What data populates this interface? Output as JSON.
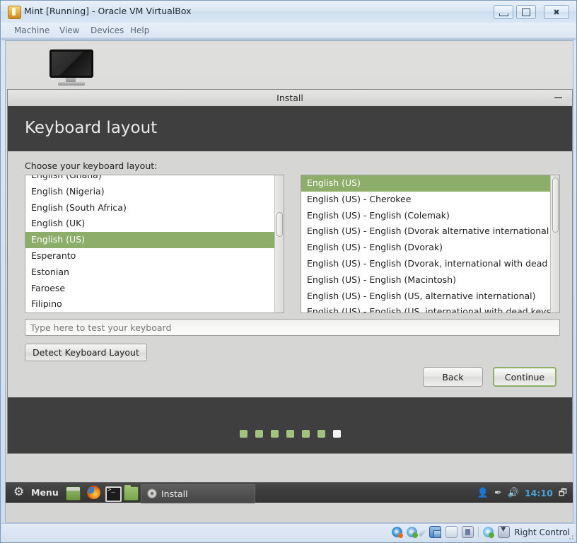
{
  "vbox": {
    "title": "Mint [Running] - Oracle VM VirtualBox",
    "icon": "virtualbox-icon",
    "window_buttons": {
      "minimize": "minimize-button",
      "maximize": "restore-button",
      "close": "close-button"
    },
    "menu": [
      "Machine",
      "View",
      "Devices",
      "Help"
    ],
    "status_bar": {
      "icons": [
        "optical-drive-icon",
        "network-icon",
        "pen-icon",
        "shared-clipboard-icon",
        "shared-folder-icon",
        "usb-icon",
        "host-network-icon",
        "host-key-icon"
      ],
      "host_key_label": "Right Control"
    }
  },
  "installer": {
    "window_title": "Install",
    "minimize": "minimize-button",
    "header_title": "Keyboard layout",
    "choose_label": "Choose your keyboard layout:",
    "left_list": {
      "name": "keyboard-language-list",
      "items": [
        {
          "label": "English (Ghana)",
          "selected": false
        },
        {
          "label": "English (Nigeria)",
          "selected": false
        },
        {
          "label": "English (South Africa)",
          "selected": false
        },
        {
          "label": "English (UK)",
          "selected": false
        },
        {
          "label": "English (US)",
          "selected": true
        },
        {
          "label": "Esperanto",
          "selected": false
        },
        {
          "label": "Estonian",
          "selected": false
        },
        {
          "label": "Faroese",
          "selected": false
        },
        {
          "label": "Filipino",
          "selected": false
        }
      ]
    },
    "right_list": {
      "name": "keyboard-variant-list",
      "items": [
        {
          "label": "English (US)",
          "selected": true
        },
        {
          "label": "English (US) - Cherokee",
          "selected": false
        },
        {
          "label": "English (US) - English (Colemak)",
          "selected": false
        },
        {
          "label": "English (US) - English (Dvorak alternative international no dead keys)",
          "selected": false
        },
        {
          "label": "English (US) - English (Dvorak)",
          "selected": false
        },
        {
          "label": "English (US) - English (Dvorak, international with dead keys)",
          "selected": false
        },
        {
          "label": "English (US) - English (Macintosh)",
          "selected": false
        },
        {
          "label": "English (US) - English (US, alternative international)",
          "selected": false
        },
        {
          "label": "English (US) - English (US, international with dead keys)",
          "selected": false
        }
      ]
    },
    "test_input": {
      "placeholder": "Type here to test your keyboard",
      "value": ""
    },
    "detect_button": "Detect Keyboard Layout",
    "back_button": "Back",
    "continue_button": "Continue",
    "progress": {
      "total_steps": 7,
      "current_step": 7
    },
    "colors": {
      "accent_green": "#8cae6a",
      "header_dark": "#3f3f3f",
      "dot_green": "#a3c17f",
      "dot_current": "#f4f4f2"
    }
  },
  "taskbar": {
    "menu_icon": "gear-icon",
    "menu_label": "Menu",
    "launchers": [
      "show-desktop-icon",
      "firefox-icon",
      "terminal-icon",
      "file-manager-icon"
    ],
    "window_button": {
      "icon": "install-disc-icon",
      "label": "Install"
    },
    "tray": {
      "icons": [
        "user-icon",
        "pen-icon",
        "volume-icon",
        "workspace-switcher-icon"
      ],
      "clock": "14:10"
    }
  }
}
